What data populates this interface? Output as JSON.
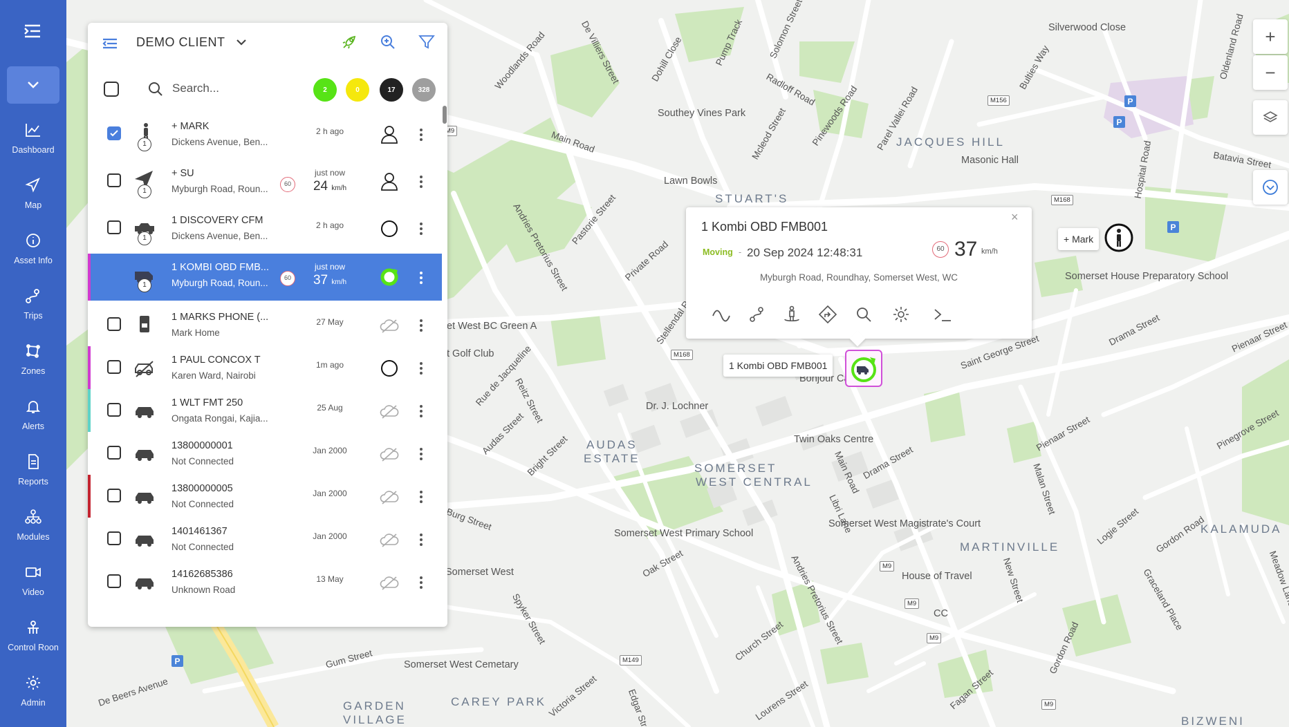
{
  "nav": {
    "items": [
      {
        "label": "Dashboard",
        "icon": "dashboard-icon"
      },
      {
        "label": "Map",
        "icon": "map-arrow-icon"
      },
      {
        "label": "Asset Info",
        "icon": "info-icon"
      },
      {
        "label": "Trips",
        "icon": "trips-icon"
      },
      {
        "label": "Zones",
        "icon": "zones-icon"
      },
      {
        "label": "Alerts",
        "icon": "bell-icon"
      },
      {
        "label": "Reports",
        "icon": "report-icon"
      },
      {
        "label": "Modules",
        "icon": "modules-icon"
      },
      {
        "label": "Video",
        "icon": "video-icon"
      },
      {
        "label": "Control Roon",
        "icon": "control-room-icon"
      },
      {
        "label": "Admin",
        "icon": "gear-icon"
      }
    ]
  },
  "panel": {
    "client": "DEMO CLIENT",
    "search_placeholder": "Search...",
    "counts": {
      "green": "2",
      "yellow": "0",
      "black": "17",
      "grey": "328"
    },
    "colors": {
      "green": "#57e316",
      "yellow": "#f5e80d",
      "black": "#222222",
      "grey": "#9e9e9e",
      "selected": "#4a7fdd"
    },
    "rows": [
      {
        "name": "+ MARK",
        "addr": "Dickens Avenue, Ben...",
        "time": "2 h ago",
        "num": "1"
      },
      {
        "name": "+ SU",
        "addr": "Myburgh Road, Roun...",
        "time": "just now",
        "speed": "24",
        "unit": "km/h",
        "limit": "60",
        "num": "1"
      },
      {
        "name": "1 DISCOVERY CFM",
        "addr": "Dickens Avenue, Ben...",
        "time": "2 h ago",
        "num": "1"
      },
      {
        "name": "1 KOMBI OBD FMB...",
        "addr": "Mybur­gh Road, Roun...",
        "time": "just now",
        "speed": "37",
        "unit": "km/h",
        "limit": "60",
        "num": "1"
      },
      {
        "name": "1 MARKS PHONE (...",
        "addr": "Mark Home",
        "time": "27 May"
      },
      {
        "name": "1 PAUL CONCOX T",
        "addr": "Karen Ward, Nairobi",
        "time": "1m ago"
      },
      {
        "name": "1 WLT FMT 250",
        "addr": "Ongata Rongai, Kajia...",
        "time": "25 Aug"
      },
      {
        "name": "13800000001",
        "addr": "Not Connected",
        "time": "Jan 2000"
      },
      {
        "name": "13800000005",
        "addr": "Not Connected",
        "time": "Jan 2000"
      },
      {
        "name": "1401461367",
        "addr": "Not Connected",
        "time": "Jan 2000"
      },
      {
        "name": "14162685386",
        "addr": "Unknown Road",
        "time": "13 May"
      }
    ]
  },
  "popup": {
    "title": "1 Kombi OBD FMB001",
    "status": "Moving",
    "dash": "-",
    "datetime": "20 Sep 2024 12:48:31",
    "limit": "60",
    "speed": "37",
    "unit": "km/h",
    "address": "Myburgh Road, Roundhay, Somerset West, WC",
    "close": "×"
  },
  "marker": {
    "label": "1 Kombi OBD FMB001"
  },
  "mark": {
    "label": "+ Mark"
  },
  "zoom": {
    "in": "+",
    "out": "−"
  },
  "map_labels": {
    "silverwood": "Silverwood Close",
    "jacques_hill": "JACQUES HILL",
    "masonic": "Masonic Hall",
    "southey": "Southey Vines Park",
    "lawn_bowls": "Lawn Bowls",
    "stuarts": "STUART'S",
    "somerset_house": "Somerset House Preparatory School",
    "dr_lochner": "Dr. J. Lochner",
    "bonjour": "Bonjour Cafe",
    "twin_oaks": "Twin Oaks Centre",
    "audas_1": "AUDAS",
    "audas_2": "ESTATE",
    "swc_1": "SOMERSET",
    "swc_2": "WEST CENTRAL",
    "magistrate": "Somerset West Magistrate's Court",
    "martinville": "MARTINVILLE",
    "kalamuda": "KALAMUDA",
    "primary": "Somerset West Primary School",
    "house_travel": "House of Travel",
    "cc": "CC",
    "cemetery": "Somerset West Cemetary",
    "carey_park": "CAREY PARK",
    "garden_1": "GARDEN",
    "garden_2": "VILLAGE",
    "bizweni": "BIZWENI",
    "bc_green": "et West BC Green A",
    "golf_club": "t Golf Club",
    "somerset_west": "Somerset West",
    "main_road": "Main Road",
    "drama_street": "Drama Street",
    "saint_george": "Saint George Street",
    "batavia": "Batavia Street",
    "pienaar": "Pienaar Street",
    "gum_street": "Gum Street",
    "de_beers": "De Beers Avenue",
    "burg_street": "Burg Street",
    "oak_street": "Oak Street",
    "church_street": "Church Street",
    "lourens": "Lourens Street",
    "victoria": "Victoria Street",
    "andries": "Andries Pretorius Street",
    "pastorie": "Pastorie Street",
    "private_road": "Private Road",
    "stellendal": "Stellendal Road",
    "bright_street": "Bright Street",
    "audas_street": "Audas Street",
    "reitz": "Reitz Street",
    "rue_de_jacqueline": "Rue de Jacqueline",
    "pinegrove": "Pinegrove Street",
    "logie": "Logie Street",
    "gordon": "Gordon Road",
    "malan": "Malan Street",
    "woodlands": "Woodlands Road",
    "de_villiers": "De Villiers Street",
    "dohill": "Dohill Close",
    "pump_track": "Pump Track",
    "solomon": "Solomon Street",
    "radloff": "Radloff Road",
    "mcleod": "Mcleod Street",
    "pinewoods": "Pinewoods Road",
    "parel_vallei": "Parel Vallei Road",
    "bulties": "Bulties Way",
    "hospital": "Hospital Road",
    "oldenland": "Oldenland Road",
    "libri": "Libri Lane",
    "fagan": "Fagan Street",
    "new_street": "New Street",
    "meadow": "Meadow Lane",
    "graceland": "Graceland Place",
    "spyker": "Spyker Street",
    "edgar": "Edgar Street",
    "m9": "M9",
    "m156": "M156",
    "m168": "M168",
    "m149": "M149"
  }
}
